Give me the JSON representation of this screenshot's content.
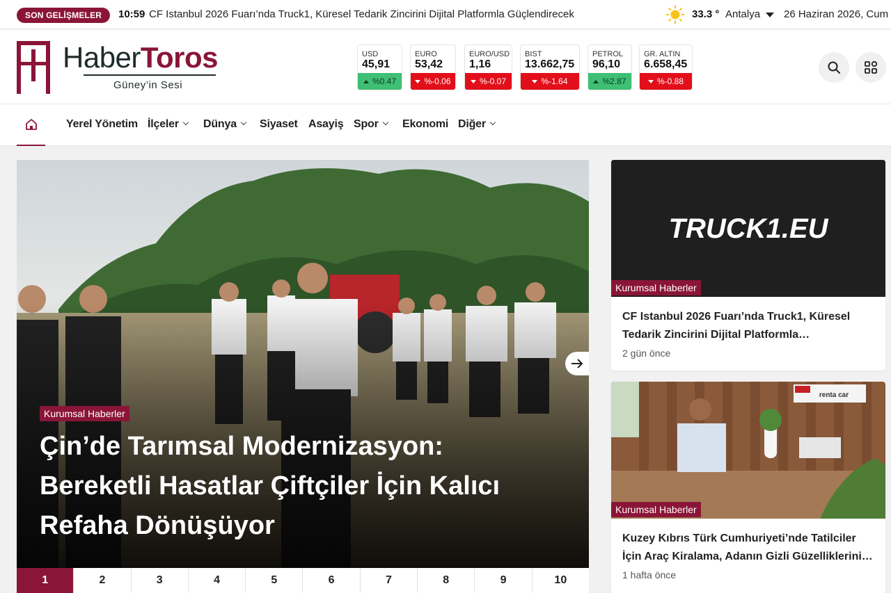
{
  "topbar": {
    "badge": "SON GELİŞMELER",
    "time": "10:59",
    "headline": "CF Istanbul 2026 Fuarı’nda Truck1, Küresel Tedarik Zincirini Dijital Platformla Güçlendirecek",
    "weather_icon": "sun-icon",
    "temperature": "33.3 °",
    "city": "Antalya",
    "date": "26 Haziran 2026, Cum"
  },
  "logo": {
    "part1": "Haber",
    "part2": "Toros",
    "slogan": "Güney’in Sesi"
  },
  "markets": [
    {
      "name": "USD",
      "value": "45,91",
      "change": "%0.47",
      "direction": "up"
    },
    {
      "name": "EURO",
      "value": "53,42",
      "change": "%-0.06",
      "direction": "down"
    },
    {
      "name": "EURO/USD",
      "value": "1,16",
      "change": "%-0.07",
      "direction": "down"
    },
    {
      "name": "BIST",
      "value": "13.662,75",
      "change": "%-1.64",
      "direction": "down"
    },
    {
      "name": "PETROL",
      "value": "96,10",
      "change": "%2.87",
      "direction": "up"
    },
    {
      "name": "GR. ALTIN",
      "value": "6.658,45",
      "change": "%-0.88",
      "direction": "down"
    }
  ],
  "nav": {
    "items": [
      {
        "label": "Yerel Yönetim",
        "has_dropdown": false
      },
      {
        "label": "İlçeler",
        "has_dropdown": true
      },
      {
        "label": "Dünya",
        "has_dropdown": true
      },
      {
        "label": "Siyaset",
        "has_dropdown": false
      },
      {
        "label": "Asayiş",
        "has_dropdown": false
      },
      {
        "label": "Spor",
        "has_dropdown": true
      },
      {
        "label": "Ekonomi",
        "has_dropdown": false
      },
      {
        "label": "Diğer",
        "has_dropdown": true
      }
    ]
  },
  "slider": {
    "category": "Kurumsal Haberler",
    "title": "Çin’de Tarımsal Modernizasyon: Bereketli Hasatlar Çiftçiler İçin Kalıcı Refaha Dönüşüyor",
    "pages": [
      "1",
      "2",
      "3",
      "4",
      "5",
      "6",
      "7",
      "8",
      "9",
      "10"
    ],
    "active_page": "1"
  },
  "cards": [
    {
      "image_text": "TRUCK1.EU",
      "category": "Kurumsal Haberler",
      "title": "CF Istanbul 2026 Fuarı’nda Truck1, Küresel Tedarik Zincirini Dijital Platformla…",
      "time": "2 gün önce"
    },
    {
      "image_text": "renta car",
      "category": "Kurumsal Haberler",
      "title": "Kuzey Kıbrıs Türk Cumhuriyeti’nde Tatilciler İçin Araç Kiralama, Adanın Gizli Güzelliklerini…",
      "time": "1 hafta önce"
    }
  ],
  "colors": {
    "brand": "#8a1538",
    "up": "#3fbf74",
    "down": "#e20f1a"
  }
}
